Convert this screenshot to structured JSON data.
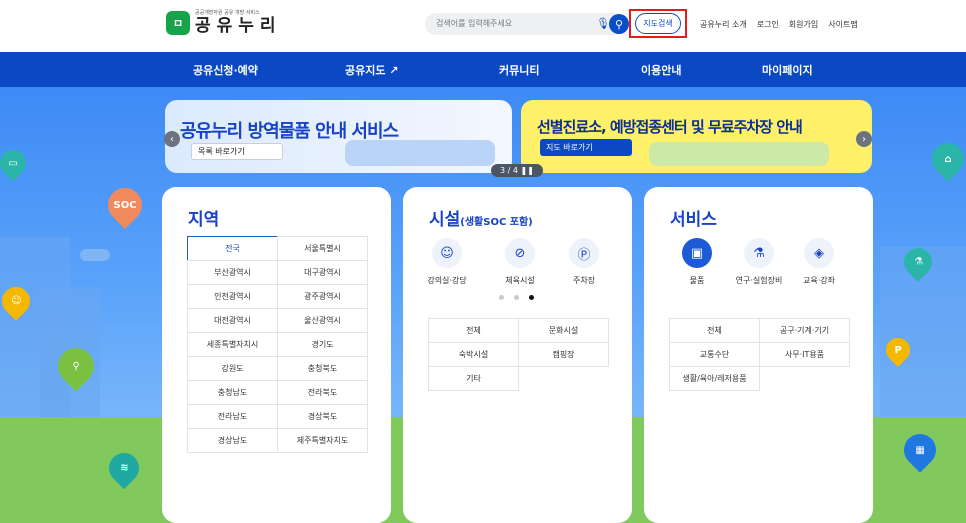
{
  "header": {
    "logo_mark": "ㅁ",
    "logo_subtitle": "공공개방자원 공유 개방 서비스",
    "logo_title": "공유누리",
    "search_placeholder": "검색어를 입력해주세요",
    "map_search_label": "지도검색",
    "util_links": [
      "공유누리 소개",
      "로그인",
      "회원가입",
      "사이트맵"
    ]
  },
  "nav": {
    "items": [
      "공유신청·예약",
      "공유지도 ↗",
      "커뮤니티",
      "이용안내",
      "마이페이지"
    ]
  },
  "banners": [
    {
      "title": "공유누리 방역물품 안내 서비스",
      "button": "목록 바로가기"
    },
    {
      "title": "선별진료소, 예방접종센터 및 무료주차장 안내",
      "button": "지도 바로가기"
    }
  ],
  "pager": {
    "text": "3 / 4  ❚❚"
  },
  "region": {
    "title": "지역",
    "items": [
      "전국",
      "서울특별시",
      "부산광역시",
      "대구광역시",
      "인천광역시",
      "광주광역시",
      "대전광역시",
      "울산광역시",
      "세종특별자치시",
      "경기도",
      "강원도",
      "충청북도",
      "충청남도",
      "전라북도",
      "전라남도",
      "경상북도",
      "경상남도",
      "제주특별자치도"
    ],
    "active": "전국"
  },
  "facility": {
    "title": "시설",
    "title_note": "(생활SOC 포함)",
    "icons": [
      {
        "label": "강의실·강당",
        "icon": "lecture-icon"
      },
      {
        "label": "체육시설",
        "icon": "sports-icon"
      },
      {
        "label": "주차장",
        "icon": "parking-icon"
      }
    ],
    "categories": [
      "전체",
      "문화시설",
      "숙박시설",
      "캠핑장",
      "기타"
    ]
  },
  "service": {
    "title": "서비스",
    "icons": [
      {
        "label": "물품",
        "icon": "gift-icon"
      },
      {
        "label": "연구·실험장비",
        "icon": "microscope-icon"
      },
      {
        "label": "교육·강좌",
        "icon": "graduation-cap-icon"
      }
    ],
    "categories": [
      "전체",
      "공구·기계·기기",
      "교통수단",
      "사무·IT용품",
      "생활/육아/레저용품"
    ]
  },
  "colors": {
    "primary": "#0b49c4",
    "highlight": "#e11d1d",
    "banner2": "#fff06a"
  }
}
